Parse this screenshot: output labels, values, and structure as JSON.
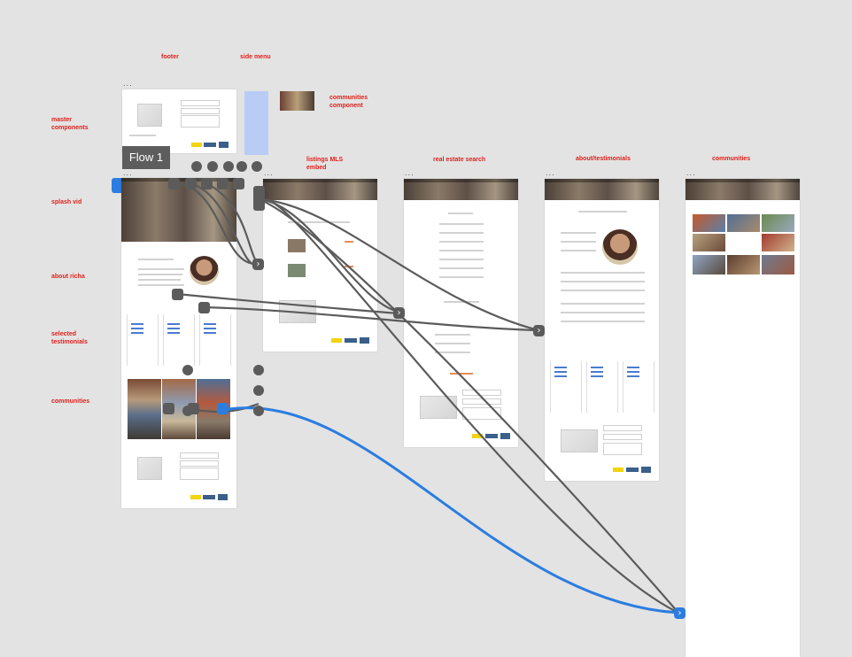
{
  "labels": {
    "footer": "footer",
    "side_menu": "side menu",
    "communities_component": "communities component",
    "master_components": "master components",
    "listings_mls_embed": "listings MLS embed",
    "real_estate_search": "real estate search",
    "about_testimonials": "about/testimonials",
    "communities": "communities",
    "splash_vid": "splash vid",
    "about_richa": "about richa",
    "selected_testimonials": "selected testimonials",
    "communities_left": "communities"
  },
  "flow": {
    "label": "Flow 1"
  },
  "artboard_menu": "...",
  "arrows": {
    "right": "›"
  },
  "colors": {
    "annotation": "#e0201b",
    "wire": "#5b5b5b",
    "wire_selected": "#2b7de0",
    "side_menu": "#b8ccf5",
    "canvas": "#e3e3e3"
  }
}
